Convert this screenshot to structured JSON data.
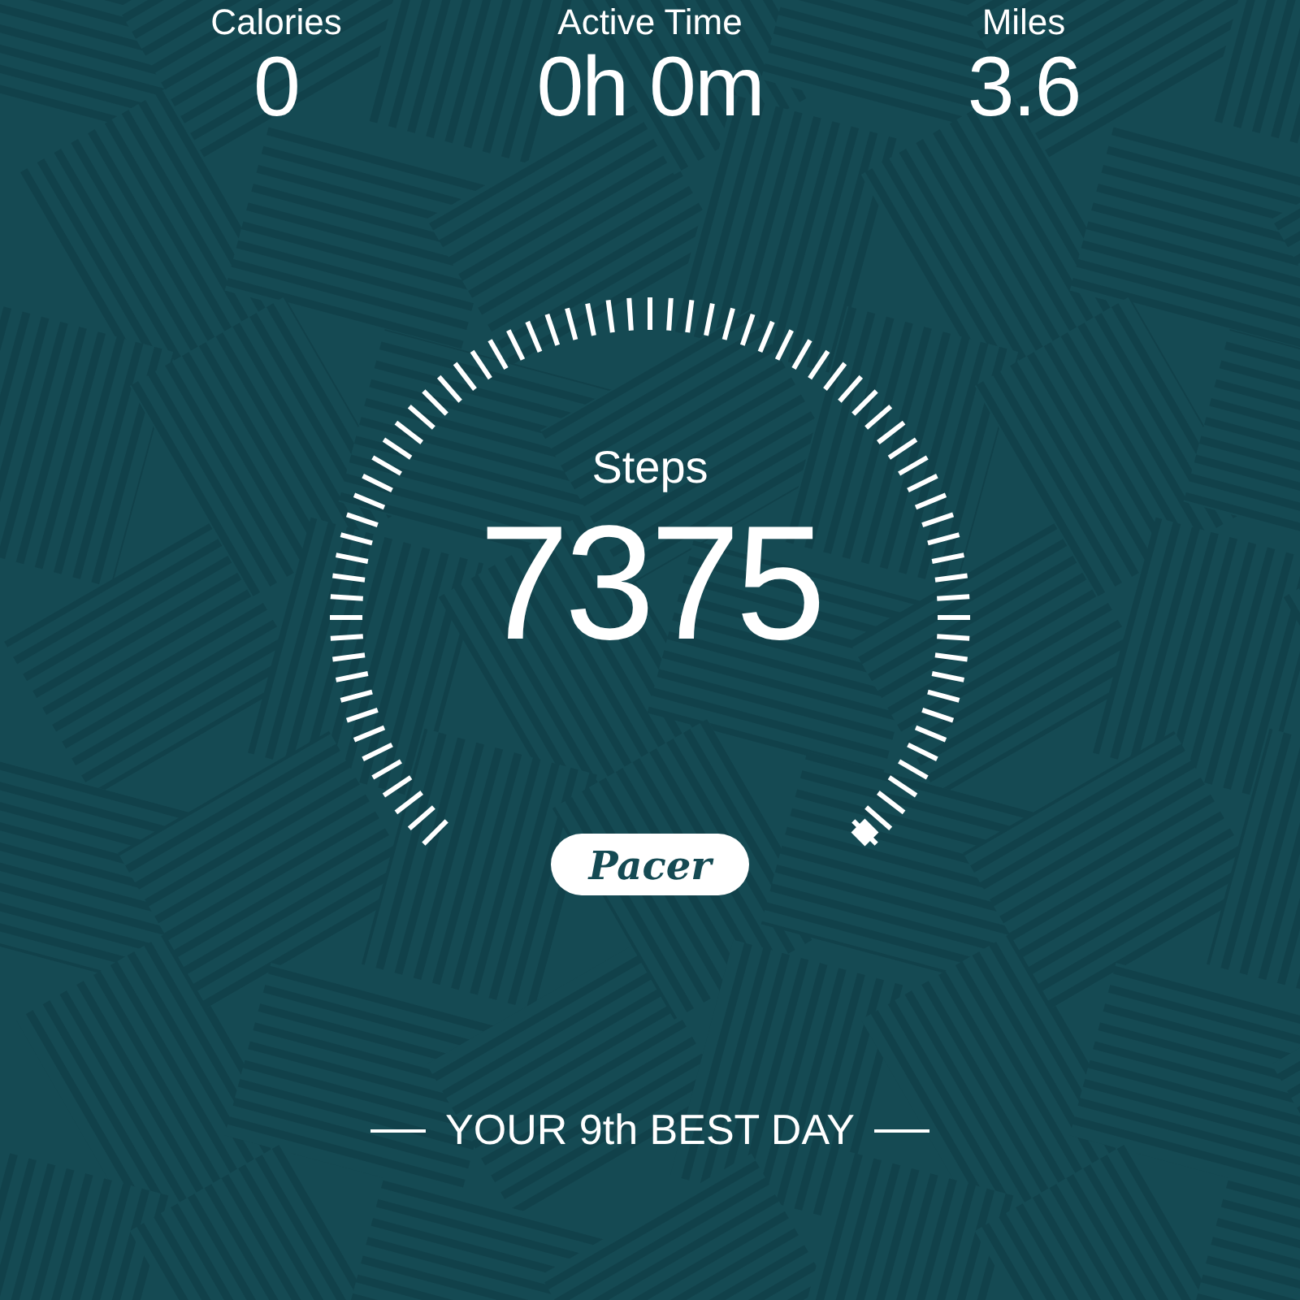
{
  "stats": [
    {
      "label": "Calories",
      "value": "0"
    },
    {
      "label": "Active Time",
      "value": "0h 0m"
    },
    {
      "label": "Miles",
      "value": "3.6"
    }
  ],
  "gauge": {
    "label": "Steps",
    "value": "7375"
  },
  "brand": "Pacer",
  "rank": "YOUR 9th BEST DAY"
}
